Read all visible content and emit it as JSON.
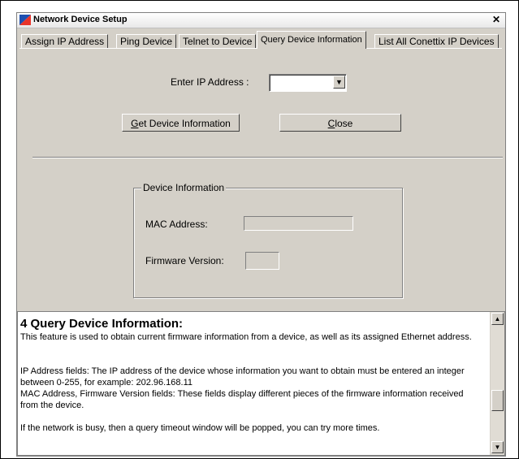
{
  "window": {
    "title": "Network Device Setup",
    "close_glyph": "✕"
  },
  "tabs": [
    {
      "label": "Assign IP Address"
    },
    {
      "label": "Ping Device"
    },
    {
      "label": "Telnet to Device"
    },
    {
      "label": "Query Device Information",
      "active": true
    },
    {
      "label": "List All Conettix IP Devices"
    }
  ],
  "form": {
    "ip_label": "Enter IP Address :",
    "ip_value": "",
    "get_button_mnemonic": "G",
    "get_button_rest": "et Device Information",
    "close_button_mnemonic": "C",
    "close_button_rest": "lose"
  },
  "device_info": {
    "group_title": "Device Information",
    "mac_label": "MAC Address:",
    "mac_value": "",
    "firmware_label": "Firmware Version:",
    "firmware_value": ""
  },
  "help": {
    "heading": "4 Query Device Information:",
    "para1": "This feature is used to obtain current firmware information from a device, as well as its assigned Ethernet address.",
    "para2": "IP Address fields: The IP address of the device whose information you want to obtain must be entered an integer between 0-255, for example: 202.96.168.11",
    "para3": "MAC Address, Firmware Version fields: These fields display different pieces of the firmware information received from the device.",
    "para4": "If the network is busy, then a query timeout window will be popped, you can try more times."
  },
  "icons": {
    "app": "network-app-icon",
    "dropdown": "chevron-down-icon",
    "scroll_up": "arrow-up-icon",
    "scroll_down": "arrow-down-icon"
  },
  "colors": {
    "dialog_bg": "#d4d0c8",
    "text": "#000000"
  }
}
